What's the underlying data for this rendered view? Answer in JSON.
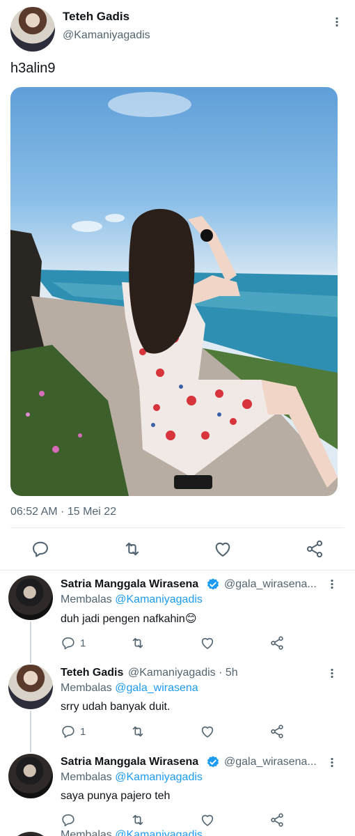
{
  "tweet": {
    "author_name": "Teteh Gadis",
    "author_handle": "@Kamaniyagadis",
    "text": "h3alin9",
    "timestamp": "06:52 AM · 15 Mei 22"
  },
  "replies": [
    {
      "name": "Satria Manggala Wirasena",
      "handle": "@gala_wirasena...",
      "verified": true,
      "replying_prefix": "Membalas ",
      "replying_to": "@Kamaniyagadis",
      "text": "duh jadi pengen nafkahin",
      "emoji": "😊",
      "reply_count": "1"
    },
    {
      "name": "Teteh Gadis",
      "handle": "@Kamaniyagadis · 5h",
      "verified": false,
      "replying_prefix": "Membalas ",
      "replying_to": "@gala_wirasena",
      "text": "srry udah banyak duit.",
      "reply_count": "1"
    },
    {
      "name": "Satria Manggala Wirasena",
      "handle": "@gala_wirasena...",
      "verified": true,
      "replying_prefix": "Membalas ",
      "replying_to": "@Kamaniyagadis",
      "text": "saya punya pajero teh",
      "reply_count": ""
    }
  ],
  "partial_next": {
    "replying_prefix": "Membalas ",
    "replying_to": "@Kamaniyagadis"
  },
  "colors": {
    "accent": "#1d9bf0",
    "secondary_text": "#536471"
  },
  "icons": [
    "reply-icon",
    "retweet-icon",
    "like-icon",
    "share-icon",
    "more-icon",
    "verified-icon"
  ]
}
